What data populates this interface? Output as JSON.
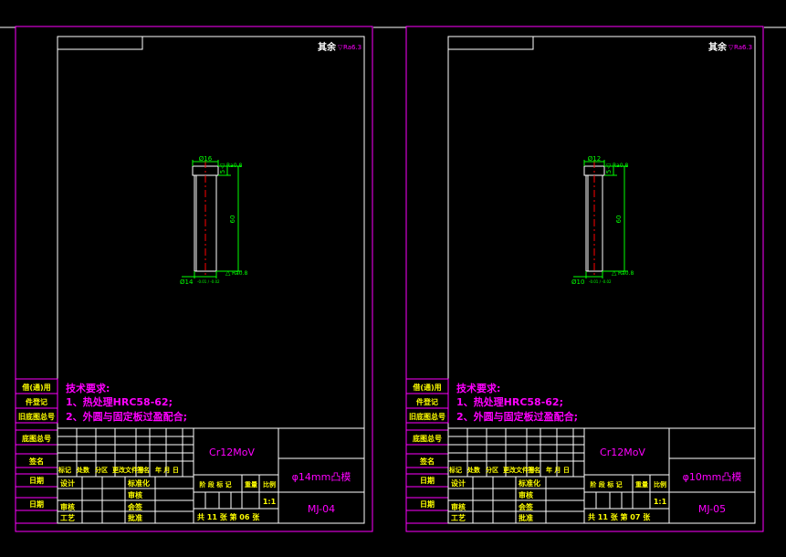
{
  "sheets": [
    {
      "id": "left",
      "rough_note": "其余",
      "rough_note_val": "Ra6.3",
      "dim_dia_top": "Ø16",
      "dim_dia_bottom": "Ø14",
      "dim_tol": "-0.01 / -0.02",
      "dim_height": "60",
      "dim_head": "5",
      "rough_top": "Ra0.8",
      "rough_bottom": "Ra0.8",
      "tech_title": "技术要求:",
      "tech_1": "1、热处理HRC58-62;",
      "tech_2": "2、外圆与固定板过盈配合;",
      "side_labels": [
        "借(通)用",
        "件登记",
        "旧底图总号",
        "底图总号",
        "签名",
        "日期",
        "日期"
      ],
      "material": "Cr12MoV",
      "part_name": "φ14mm凸模",
      "drawing_no": "MJ-04",
      "scale": "1:1",
      "sheet_info": "共 11 张   第 06 张",
      "rev_headers": [
        "标记",
        "处数",
        "分区",
        "更改文件号",
        "签名",
        "年 月 日"
      ],
      "sign_rows": [
        [
          "设计",
          "标准化"
        ],
        [
          "",
          "审核"
        ],
        [
          "审核",
          "会签"
        ],
        [
          "工艺",
          "批准"
        ]
      ],
      "stage_headers": [
        "阶 段 标 记",
        "重量",
        "比例"
      ]
    },
    {
      "id": "right",
      "rough_note": "其余",
      "rough_note_val": "Ra6.3",
      "dim_dia_top": "Ø12",
      "dim_dia_bottom": "Ø10",
      "dim_tol": "-0.01 / -0.02",
      "dim_height": "60",
      "dim_head": "5",
      "rough_top": "Ra0.8",
      "rough_bottom": "Ra0.8",
      "tech_title": "技术要求:",
      "tech_1": "1、热处理HRC58-62;",
      "tech_2": "2、外圆与固定板过盈配合;",
      "side_labels": [
        "借(通)用",
        "件登记",
        "旧底图总号",
        "底图总号",
        "签名",
        "日期",
        "日期"
      ],
      "material": "Cr12MoV",
      "part_name": "φ10mm凸模",
      "drawing_no": "MJ-05",
      "scale": "1:1",
      "sheet_info": "共 11 张   第 07 张",
      "rev_headers": [
        "标记",
        "处数",
        "分区",
        "更改文件号",
        "签名",
        "年 月 日"
      ],
      "sign_rows": [
        [
          "设计",
          "标准化"
        ],
        [
          "",
          "审核"
        ],
        [
          "审核",
          "会签"
        ],
        [
          "工艺",
          "批准"
        ]
      ],
      "stage_headers": [
        "阶 段 标 记",
        "重量",
        "比例"
      ]
    }
  ],
  "colors": {
    "background": "#000000",
    "border": "#ff00ff",
    "frame": "#ffffff",
    "dimension": "#00ff00",
    "centerline": "#ff0000",
    "text_title": "#ff00ff",
    "text_table": "#ffff00"
  }
}
